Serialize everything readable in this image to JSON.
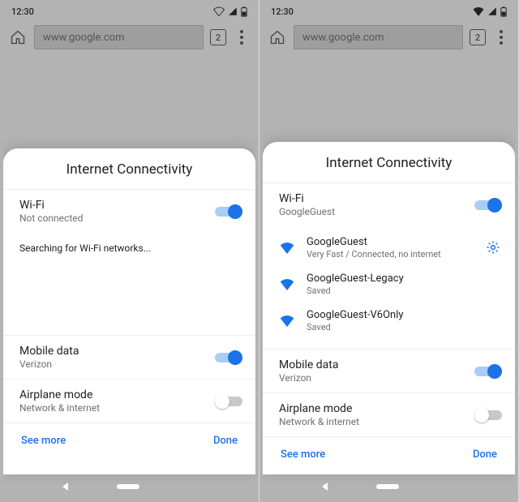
{
  "status": {
    "time": "12:30"
  },
  "toolbar": {
    "url": "www.google.com",
    "tab_count": "2"
  },
  "sheetA": {
    "title": "Internet Connectivity",
    "wifi": {
      "label": "Wi-Fi",
      "sublabel": "Not connected",
      "on": true
    },
    "status_line": "Searching for Wi-Fi networks...",
    "mobile": {
      "label": "Mobile data",
      "sublabel": "Verizon",
      "on": true
    },
    "airplane": {
      "label": "Airplane mode",
      "sublabel": "Network & internet",
      "on": false
    },
    "see_more": "See more",
    "done": "Done"
  },
  "sheetB": {
    "title": "Internet Connectivity",
    "wifi": {
      "label": "Wi-Fi",
      "sublabel": "GoogleGuest",
      "on": true
    },
    "networks": [
      {
        "name": "GoogleGuest",
        "sub": "Very Fast / Connected, no internet",
        "gear": true
      },
      {
        "name": "GoogleGuest-Legacy",
        "sub": "Saved",
        "gear": false
      },
      {
        "name": "GoogleGuest-V6Only",
        "sub": "Saved",
        "gear": false
      }
    ],
    "mobile": {
      "label": "Mobile data",
      "sublabel": "Verizon",
      "on": true
    },
    "airplane": {
      "label": "Airplane mode",
      "sublabel": "Network & internet",
      "on": false
    },
    "see_more": "See more",
    "done": "Done"
  }
}
